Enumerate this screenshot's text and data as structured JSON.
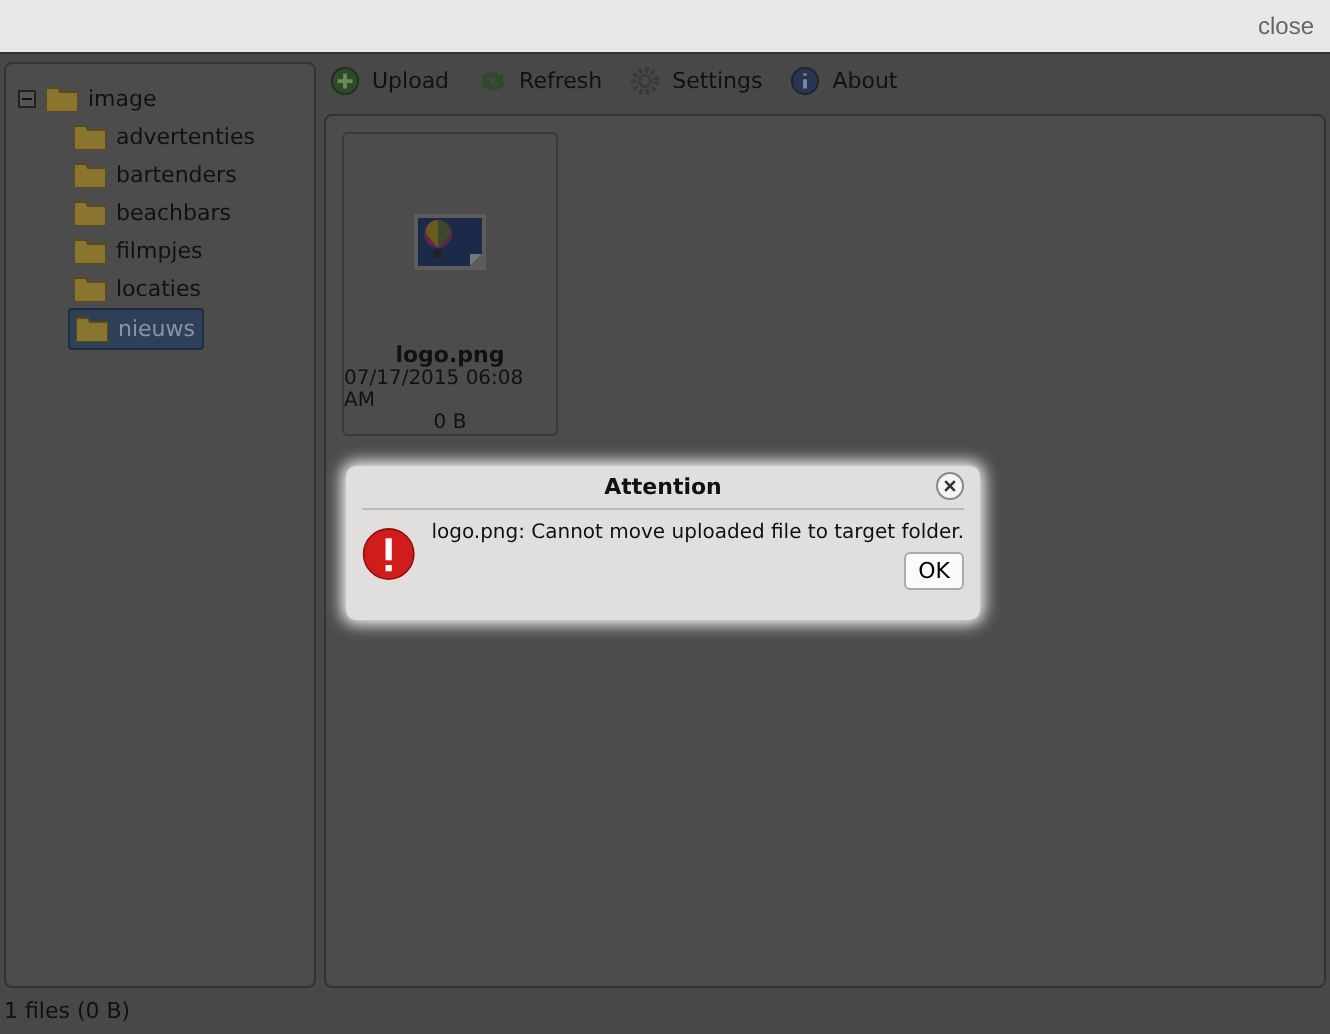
{
  "top_bar": {
    "close_link": "close"
  },
  "folder_tree": [
    {
      "label": "image",
      "expanded": true,
      "selected": false,
      "children": [
        {
          "label": "advertenties",
          "selected": false
        },
        {
          "label": "bartenders",
          "selected": false
        },
        {
          "label": "beachbars",
          "selected": false
        },
        {
          "label": "filmpjes",
          "selected": false
        },
        {
          "label": "locaties",
          "selected": false
        },
        {
          "label": "nieuws",
          "selected": true
        }
      ]
    }
  ],
  "toolbar": [
    {
      "kind": "upload",
      "label": "Upload"
    },
    {
      "kind": "refresh",
      "label": "Refresh"
    },
    {
      "kind": "settings",
      "label": "Settings"
    },
    {
      "kind": "about",
      "label": "About"
    }
  ],
  "files": [
    {
      "name": "logo.png",
      "date": "07/17/2015 06:08 AM",
      "size": "0 B"
    }
  ],
  "status_bar": "1 files (0 B)",
  "dialog": {
    "title": "Attention",
    "message": "logo.png: Cannot move uploaded file to target folder.",
    "button": "OK"
  }
}
